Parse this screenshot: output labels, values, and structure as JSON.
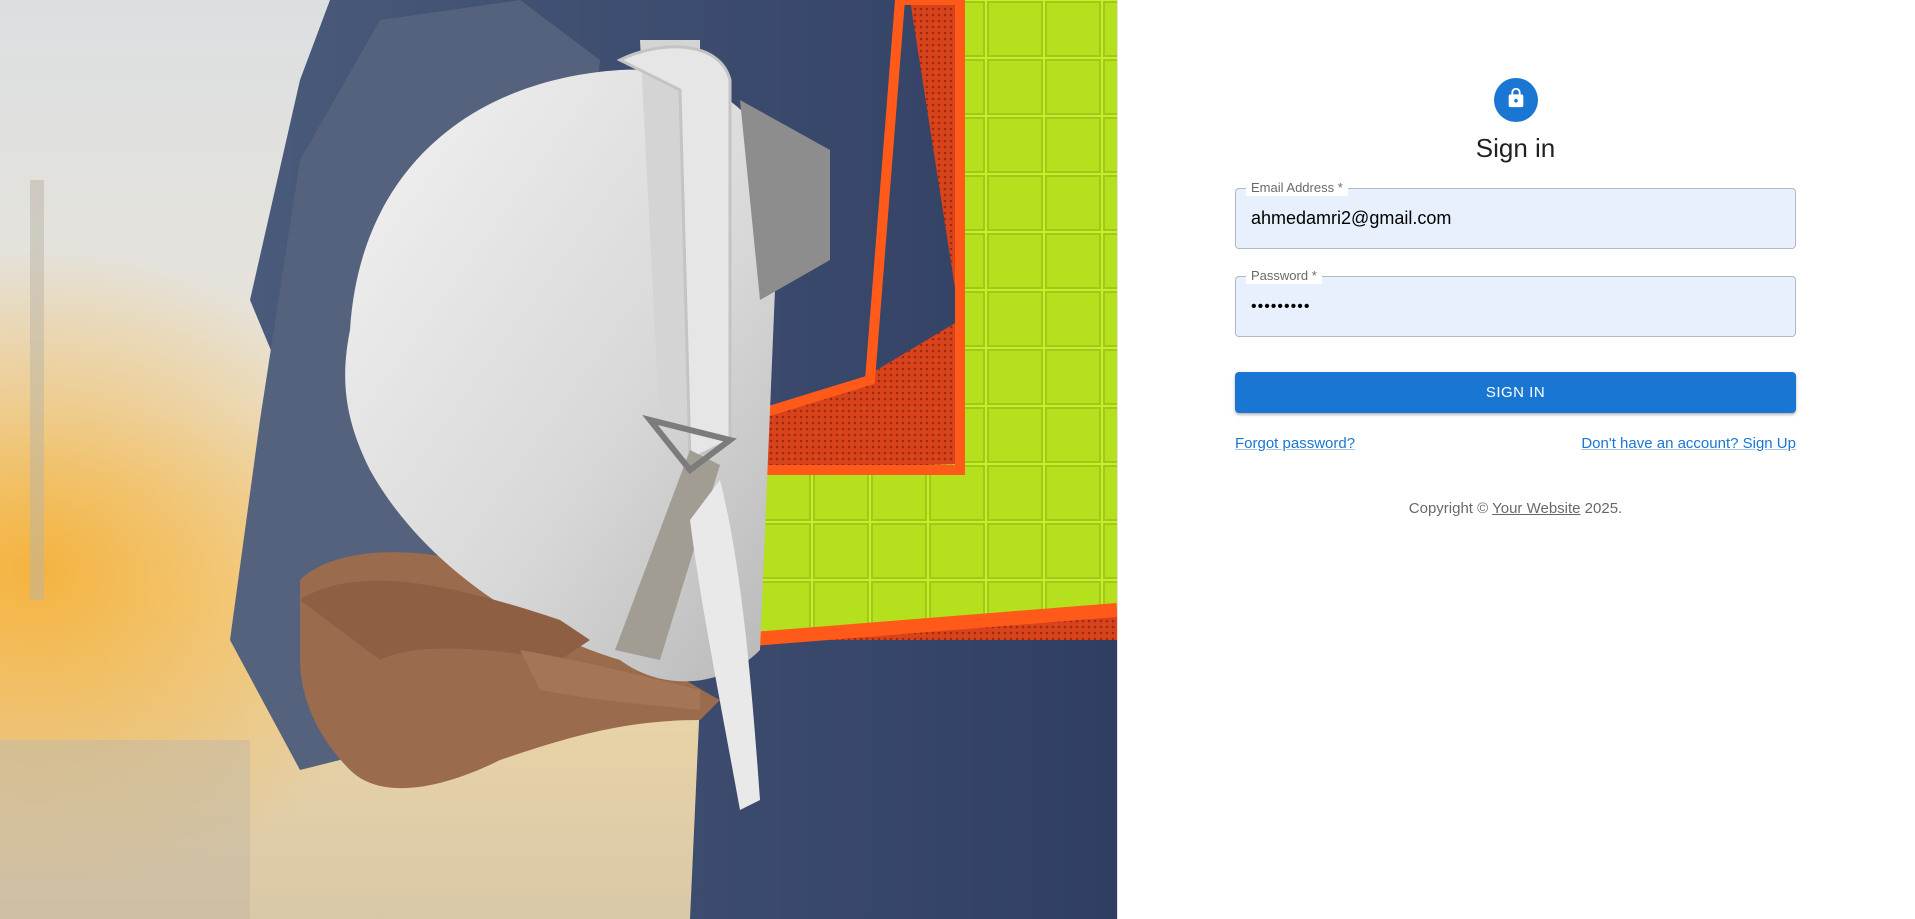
{
  "colors": {
    "primary": "#1976d2",
    "input_fill": "#e8f0fe",
    "text_secondary": "rgba(0,0,0,0.6)"
  },
  "hero": {
    "icon": "hardhat-worker-photo"
  },
  "form": {
    "avatar_icon": "lock-icon",
    "title": "Sign in",
    "email": {
      "label": "Email Address *",
      "value": "ahmedamri2@gmail.com"
    },
    "password": {
      "label": "Password *",
      "value": "•••••••••"
    },
    "submit_label": "SIGN IN",
    "forgot_link": "Forgot password?",
    "signup_link": "Don't have an account? Sign Up"
  },
  "footer": {
    "prefix": "Copyright © ",
    "link": "Your Website",
    "suffix": " 2025."
  }
}
